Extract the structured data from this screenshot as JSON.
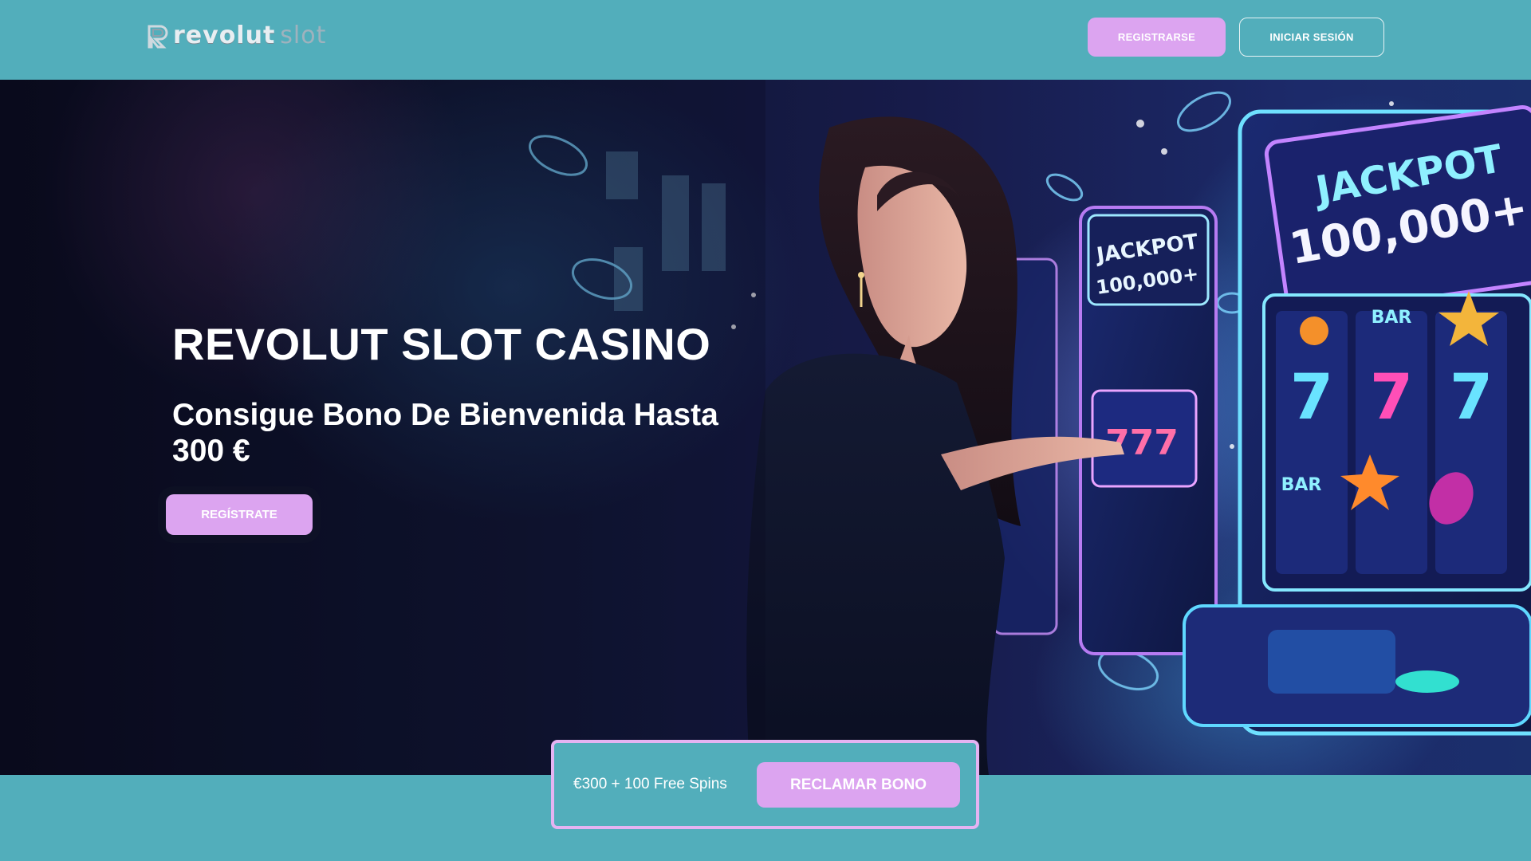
{
  "header": {
    "logo": {
      "word1": "revolut",
      "word2": "slot"
    },
    "register_label": "REGISTRARSE",
    "login_label": "INICIAR SESIÓN"
  },
  "hero": {
    "title": "REVOLUT SLOT CASINO",
    "subtitle": "Consigue Bono De Bienvenida Hasta 300 €",
    "cta_label": "REGÍSTRATE",
    "image": {
      "jackpot_big": "JACKPOT",
      "jackpot_big_amount": "100,000+",
      "jackpot_small": "JACKPOT",
      "jackpot_small_amount": "100,000+",
      "reel_777": "777",
      "symbol_bar": "BAR"
    }
  },
  "bonus_bar": {
    "offer_text": "€300 + 100 Free Spins",
    "claim_label": "RECLAMAR BONO"
  },
  "colors": {
    "background": "#52aebb",
    "accent": "#dca4f0",
    "bonus_border": "#e5b3f2"
  }
}
